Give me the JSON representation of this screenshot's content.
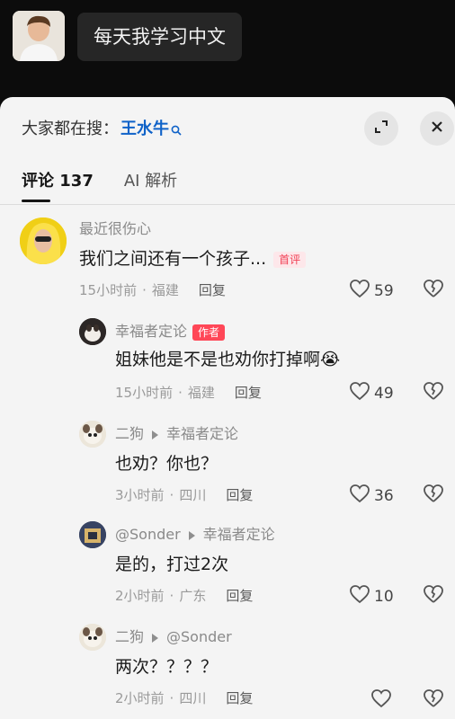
{
  "video": {
    "subtitle": "每天我学习中文"
  },
  "sheet": {
    "search_prefix": "大家都在搜：",
    "search_term": "王水牛",
    "tabs": [
      {
        "label": "评论 137",
        "active": true
      },
      {
        "label": "AI 解析",
        "active": false
      }
    ]
  },
  "comments": [
    {
      "name": "最近很伤心",
      "text": "我们之间还有一个孩子...",
      "badge": "首评",
      "time": "15小时前",
      "location": "福建",
      "reply": "回复",
      "likes": "59"
    },
    {
      "name": "幸福者定论",
      "badge": "作者",
      "text": "姐妹他是不是也劝你打掉啊",
      "emoji": "😭",
      "time": "15小时前",
      "location": "福建",
      "reply": "回复",
      "likes": "49"
    },
    {
      "name": "二狗",
      "reply_to": "幸福者定论",
      "text": "也劝？你也？",
      "time": "3小时前",
      "location": "四川",
      "reply": "回复",
      "likes": "36"
    },
    {
      "name": "@Sonder",
      "reply_to": "幸福者定论",
      "text": "是的，打过2次",
      "time": "2小时前",
      "location": "广东",
      "reply": "回复",
      "likes": "10"
    },
    {
      "name": "二狗",
      "reply_to": "@Sonder",
      "text": "两次？？？？",
      "time": "2小时前",
      "location": "四川",
      "reply": "回复",
      "likes": ""
    }
  ],
  "colors": {
    "accent_link": "#0f62c8",
    "author_badge": "#ff4757",
    "top_badge_text": "#f13e53"
  }
}
